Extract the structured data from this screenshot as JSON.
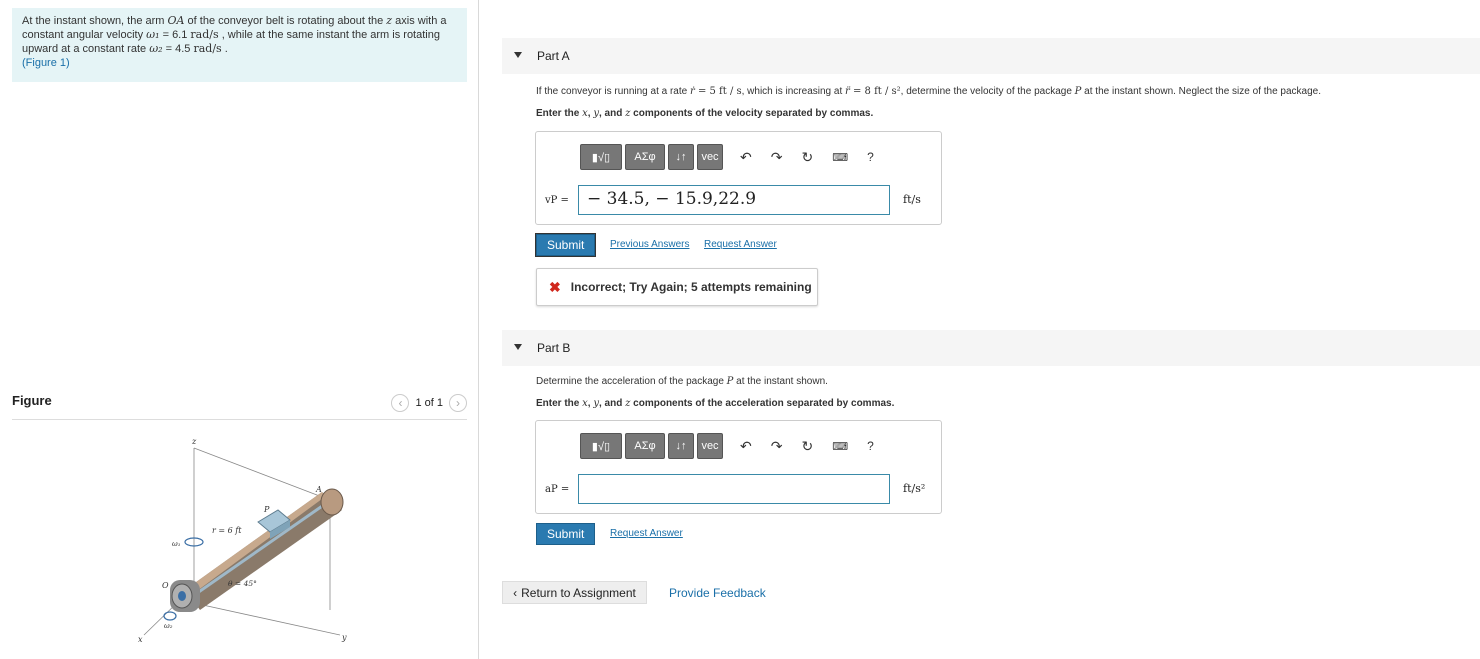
{
  "problem": {
    "line1": "At the instant shown, the arm ",
    "arm": "OA",
    "line1b": " of the conveyor belt is rotating about the ",
    "axis": "z",
    "line1c": " axis with a",
    "line2": "constant angular velocity ",
    "w1": "ω₁",
    "eq1": " = 6.1 ",
    "u1": "rad/s",
    "line2b": " , while at the same instant the arm is rotating",
    "line3": "upward at a constant rate ",
    "w2": "ω₂",
    "eq2": " = 4.5 ",
    "u2": "rad/s",
    "line3b": " .",
    "figure_link": "(Figure 1)"
  },
  "figure": {
    "title": "Figure",
    "pager": "1 of 1",
    "labels": {
      "z": "z",
      "w1": "ω₁",
      "r": "r = 6 ft",
      "P": "P",
      "A": "A",
      "O": "O",
      "theta": "θ = 45°",
      "w2": "ω₂",
      "x": "x",
      "y": "y"
    }
  },
  "partA": {
    "label": "Part A",
    "q1a": "If the conveyor is running at a rate ",
    "rdot": "ṙ",
    "q1b": " = 5 ft / s",
    "q1c": ", which is increasing at ",
    "rddot": "r̈",
    "q1d": " = 8 ft / s²",
    "q1e": ", determine the velocity of the package ",
    "pkg": "P",
    "q1f": " at the instant shown. Neglect the size of the package.",
    "q2a": "Enter the ",
    "x": "x",
    "q2b": ", ",
    "y": "y",
    "q2c": ", and ",
    "z": "z",
    "q2d": " components of the velocity separated by commas.",
    "var": "vP =",
    "value": "− 34.5, − 15.9,22.9",
    "unit": "ft/s",
    "submit": "Submit",
    "prev": "Previous Answers",
    "request": "Request Answer",
    "feedback": "Incorrect; Try Again; 5 attempts remaining"
  },
  "partB": {
    "label": "Part B",
    "q1a": "Determine the acceleration of the package ",
    "pkg": "P",
    "q1b": " at the instant shown.",
    "q2a": "Enter the ",
    "x": "x",
    "q2b": ", ",
    "y": "y",
    "q2c": ", and ",
    "z": "z",
    "q2d": " components of the acceleration separated by commas.",
    "var": "aP =",
    "value": "",
    "unit": "ft/s²",
    "submit": "Submit",
    "request": "Request Answer"
  },
  "toolbar": {
    "templates": "▮√▯",
    "greek": "ΑΣφ",
    "arrows": "↓↑",
    "vec": "vec",
    "help": "?"
  },
  "footer": {
    "return": "Return to Assignment",
    "provide": "Provide Feedback"
  }
}
